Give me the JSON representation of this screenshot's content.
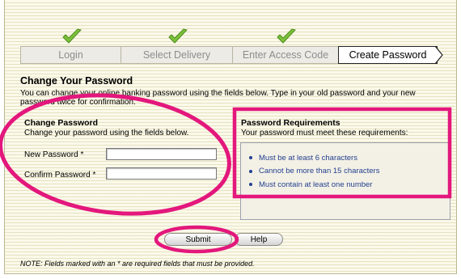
{
  "steps": [
    {
      "label": "Login",
      "done": true
    },
    {
      "label": "Select Delivery",
      "done": true
    },
    {
      "label": "Enter Access Code",
      "done": true
    },
    {
      "label": "Create Password",
      "done": false,
      "active": true
    }
  ],
  "heading": "Change Your Password",
  "intro": "You can change your online banking password using the fields below. Type in your old password and your new password twice for confirmation.",
  "change": {
    "title": "Change Password",
    "desc": "Change your password using the fields below.",
    "new_label": "New Password *",
    "confirm_label": "Confirm Password *",
    "new_value": "",
    "confirm_value": ""
  },
  "requirements": {
    "title": "Password Requirements",
    "desc": "Your password must meet these requirements:",
    "items": [
      "Must be at least 6 characters",
      "Cannot be more than 15 characters",
      "Must contain at least one number"
    ]
  },
  "buttons": {
    "submit": "Submit",
    "help": "Help"
  },
  "note": "NOTE: Fields marked with an * are required fields that must be provided.",
  "colors": {
    "highlight": "#e3177c",
    "check": "#7bc23a",
    "link": "#243f8f"
  }
}
